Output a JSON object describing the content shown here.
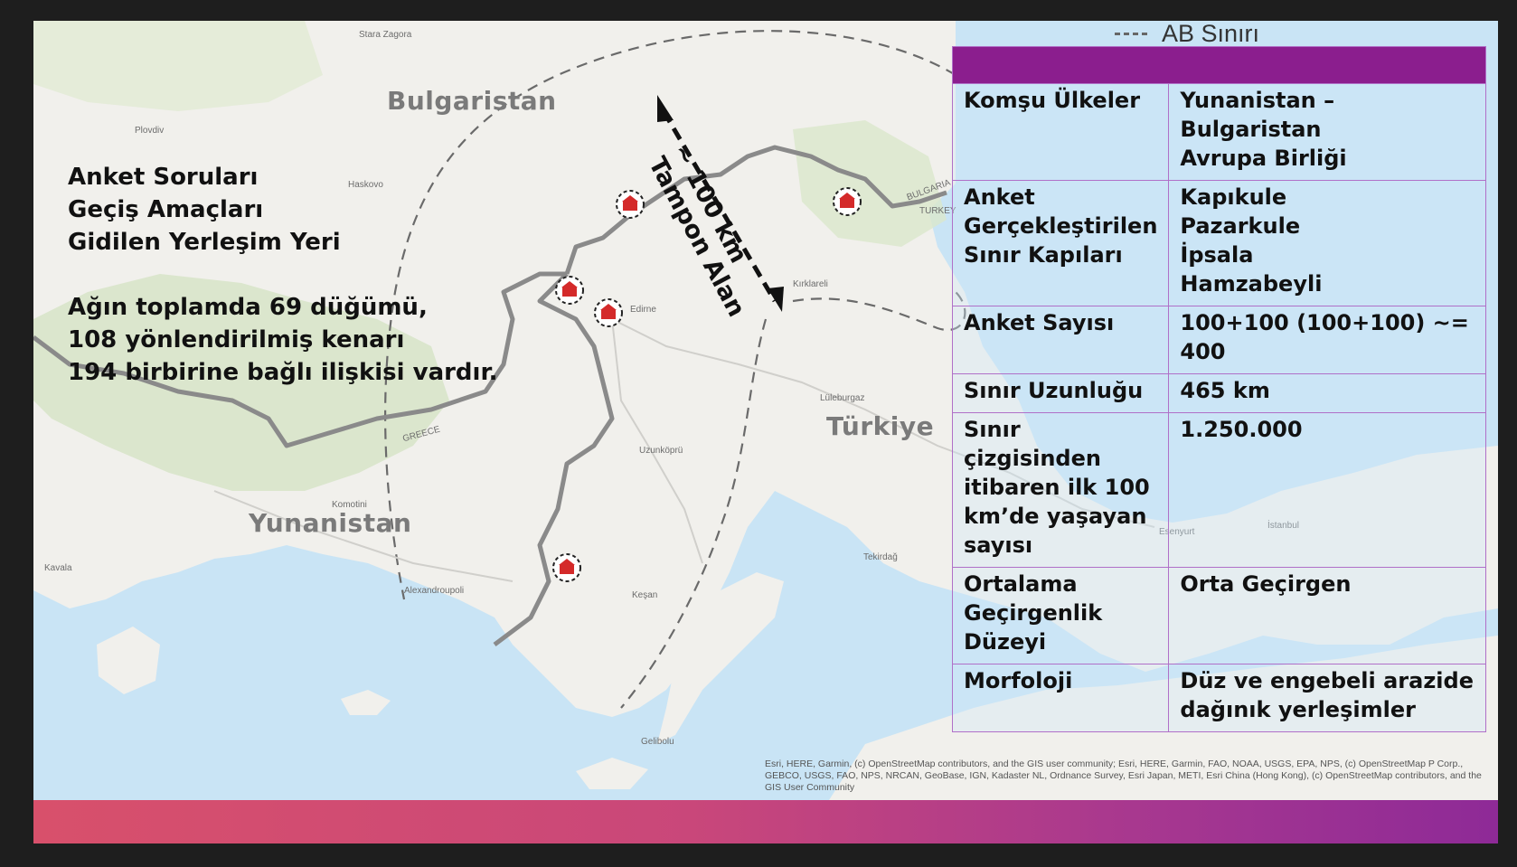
{
  "map": {
    "countries": {
      "bulgaria": "Bulgaristan",
      "greece": "Yunanistan",
      "turkey": "Türkiye"
    },
    "places": [
      "Stara Zagora",
      "Haskovo",
      "Kırklareli",
      "Edirne",
      "Uzunköprü",
      "Lüleburgaz",
      "Tekirdağ",
      "Keşan",
      "Alexandroupoli",
      "Komotini",
      "Kavala",
      "İstanbul",
      "Esenyurt",
      "Gelibolu",
      "Plovdiv",
      "BULGARIA",
      "TURKEY",
      "GREECE"
    ],
    "buffer_label_line1": "~ 100 km",
    "buffer_label_line2": "Tampon Alan",
    "border_crossings_icon": "customs-gate-icon",
    "attribution": "Esri, HERE, Garmin, (c) OpenStreetMap contributors, and the GIS user community; Esri, HERE, Garmin, FAO, NOAA, USGS, EPA, NPS, (c) OpenStreetMap P Corp., GEBCO, USGS, FAO, NPS, NRCAN, GeoBase, IGN, Kadaster NL, Ordnance Survey, Esri Japan, METI, Esri China (Hong Kong), (c) OpenStreetMap contributors, and the GIS User Community"
  },
  "legend": {
    "label": "AB Sınırı"
  },
  "left_text": {
    "line1": "Anket Soruları",
    "line2": "Geçiş Amaçları",
    "line3": "Gidilen Yerleşim Yeri",
    "line4": "Ağın toplamda 69 düğümü,",
    "line5": "108 yönlendirilmiş kenarı",
    "line6": "194 birbirine bağlı ilişkisi vardır."
  },
  "table": {
    "rows": [
      {
        "key": "Komşu Ülkeler",
        "value": "Yunanistan – Bulgaristan\nAvrupa Birliği"
      },
      {
        "key": "Anket Gerçekleştirilen Sınır Kapıları",
        "value": "Kapıkule\nPazarkule\nİpsala\nHamzabeyli"
      },
      {
        "key": "Anket Sayısı",
        "value": "100+100 (100+100) ~= 400"
      },
      {
        "key": "Sınır Uzunluğu",
        "value": "465 km"
      },
      {
        "key": "Sınır çizgisinden itibaren ilk 100 km’de yaşayan sayısı",
        "value": "1.250.000"
      },
      {
        "key": "Ortalama Geçirgenlik Düzeyi",
        "value": "Orta Geçirgen"
      },
      {
        "key": "Morfoloji",
        "value": "Düz ve engebeli arazide dağınık yerleşimler"
      }
    ]
  },
  "colors": {
    "table_header": "#8b1e8e",
    "table_border": "#b070c8",
    "footer_start": "#d8506b",
    "footer_end": "#8e2a97",
    "sea": "#c9e4f5",
    "land": "#f2f1ee",
    "border_line": "#8a8a8a"
  }
}
